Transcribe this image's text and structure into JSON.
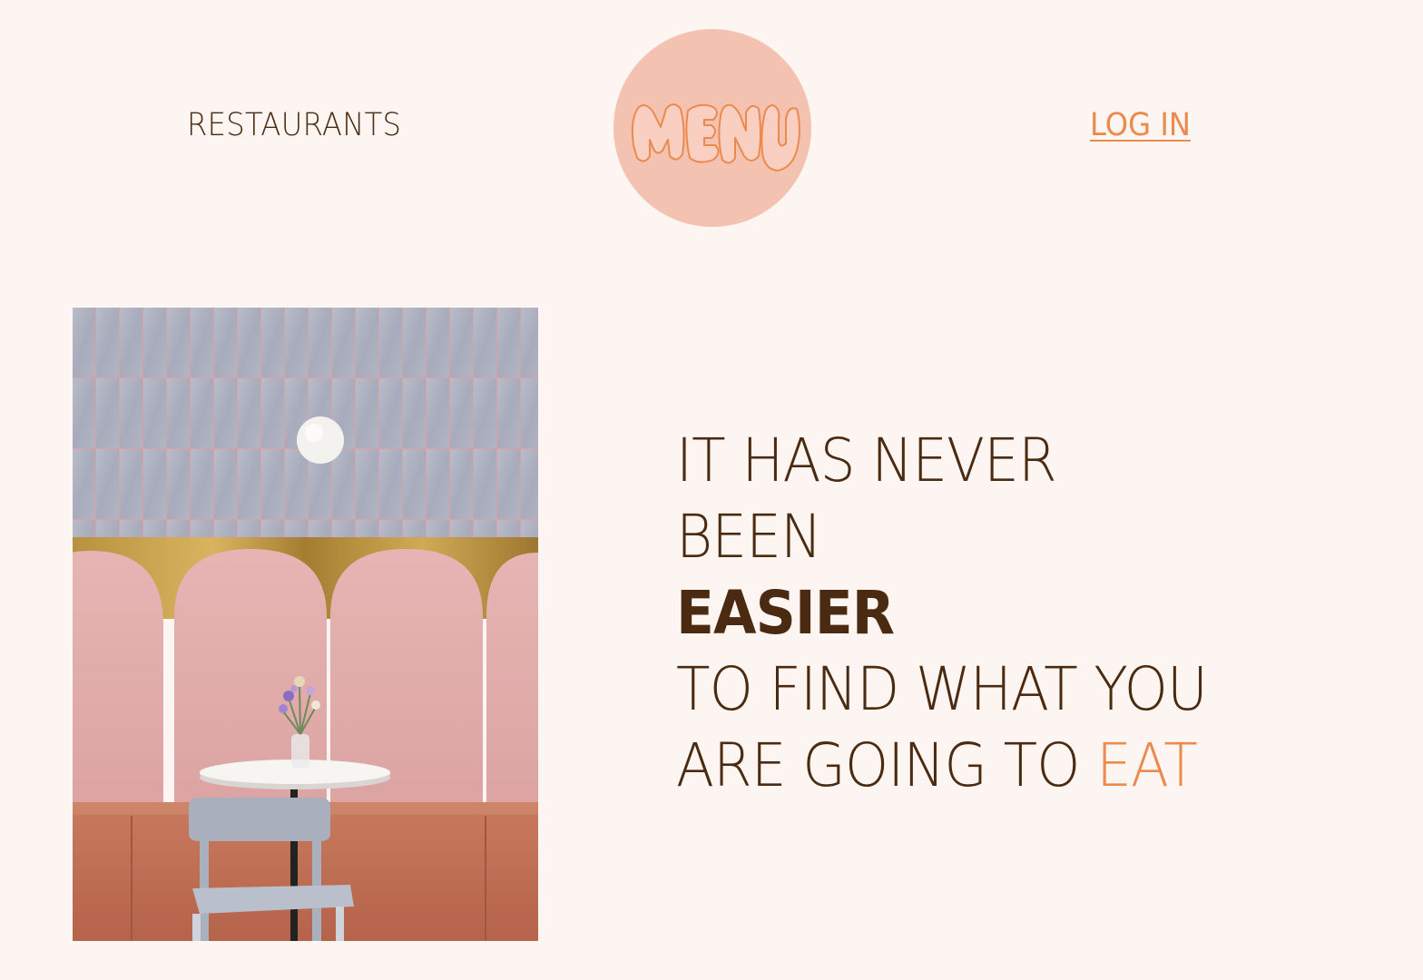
{
  "nav": {
    "left_link": "RESTAURANTS",
    "right_link": "LOG IN"
  },
  "logo": {
    "text": "MENU",
    "icon": "menu-logo-icon",
    "bg_color": "#f4c2b0",
    "ink_color": "#ec8a4e"
  },
  "hero": {
    "image_description_icon": "restaurant-booth-photo",
    "headline": {
      "line1": "IT HAS NEVER",
      "line2": "BEEN",
      "line3": "EASIER",
      "line4": "TO FIND WHAT YOU",
      "line5_prefix": "ARE GOING TO",
      "line5_accent": "EAT"
    }
  },
  "colors": {
    "background": "#fdf5f1",
    "text": "#4a2a10",
    "accent": "#ec8a4e"
  }
}
